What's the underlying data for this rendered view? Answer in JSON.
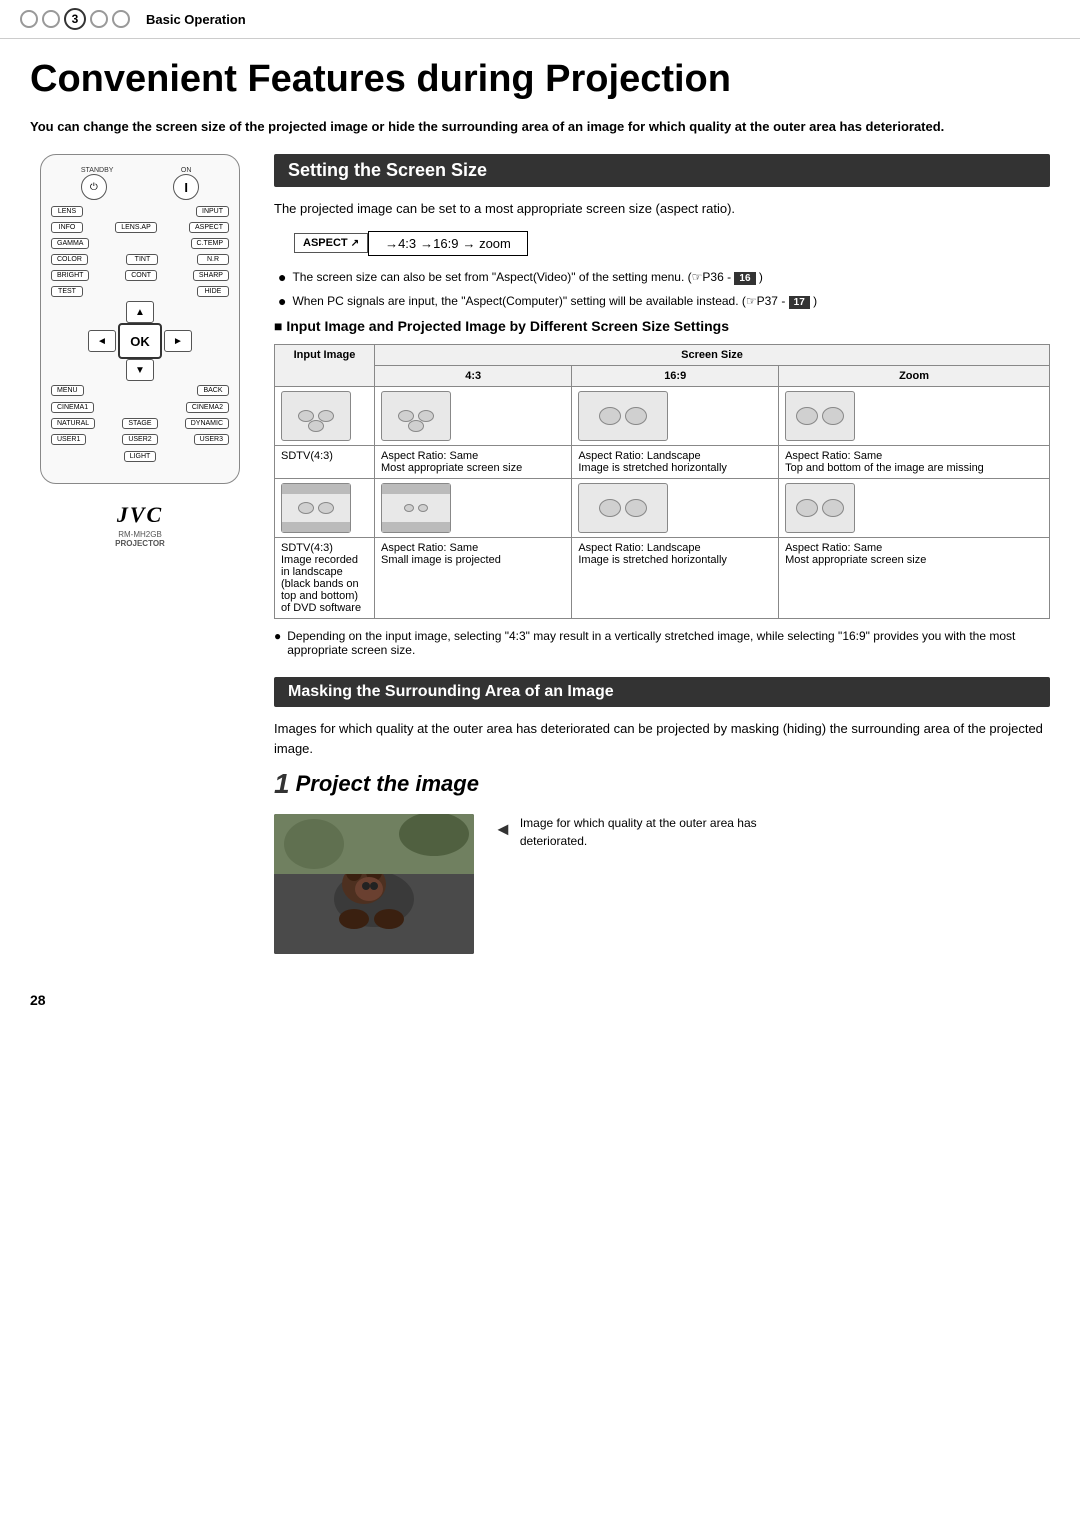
{
  "header": {
    "step_number": "3",
    "title": "Basic Operation"
  },
  "main_title": "Convenient Features during Projection",
  "intro_text": "You can change the screen size of the projected image or hide the surrounding area of an image for which quality at the outer area has deteriorated.",
  "section1": {
    "title": "Setting the Screen Size",
    "text": "The projected image can be set to a most appropriate screen size (aspect ratio).",
    "aspect_btn": "ASPECT",
    "aspect_sequence": "→4:3 →16:9 → zoom",
    "bullets": [
      "The screen size can also be set from \"Aspect(Video)\" of the setting menu. (☞P36 - 16 )",
      "When PC signals are input, the \"Aspect(Computer)\" setting will be available instead. (☞P37 - 17 )"
    ],
    "table_section_title": "■ Input Image and Projected Image by Different Screen Size Settings",
    "table": {
      "header_col1": "Input Image",
      "header_screen_size": "Screen Size",
      "col_43": "4:3",
      "col_169": "16:9",
      "col_zoom": "Zoom",
      "row1": {
        "label": "SDTV(4:3)",
        "col_43": "Aspect Ratio: Same\nMost appropriate screen size",
        "col_169": "Aspect Ratio: Landscape\nImage is stretched horizontally",
        "col_zoom": "Aspect Ratio: Same\nTop and bottom of the image are missing"
      },
      "row2": {
        "label": "SDTV(4:3)\nImage recorded in landscape (black bands on top and bottom) of DVD software",
        "col_43": "Aspect Ratio: Same\nSmall image is projected",
        "col_169": "Aspect Ratio: Landscape\nImage is stretched horizontally",
        "col_zoom": "Aspect Ratio: Same\nMost appropriate screen size"
      }
    },
    "note_text": "Depending on the input image, selecting \"4:3\" may result in a vertically stretched image, while selecting \"16:9\" provides you with the most appropriate screen size."
  },
  "section2": {
    "title": "Masking the Surrounding Area of an Image",
    "intro": "Images for which quality at the outer area has deteriorated can be projected by masking (hiding) the surrounding area of the projected image.",
    "step1": {
      "num": "1",
      "title": "Project the image",
      "caption": "Image for which quality at the outer area has deteriorated."
    }
  },
  "remote": {
    "standby_label": "STANDBY",
    "on_label": "ON",
    "buttons": {
      "lens": "LENS",
      "input": "INPUT",
      "info": "INFO",
      "lens_ap": "LENS.AP",
      "aspect": "ASPECT",
      "gamma": "GAMMA",
      "c_temp": "C.TEMP",
      "color": "COLOR",
      "tint": "TINT",
      "nr": "N.R",
      "bright": "BRIGHT",
      "cont": "CONT",
      "sharp": "SHARP",
      "test": "TEST",
      "hide": "HIDE",
      "ok": "OK",
      "menu": "MENU",
      "back": "BACK",
      "cinema1": "CINEMA1",
      "cinema2": "CINEMA2",
      "natural": "NATURAL",
      "stage": "STAGE",
      "dynamic": "DYNAMIC",
      "user1": "USER1",
      "user2": "USER2",
      "user3": "USER3",
      "light": "LIGHT"
    },
    "model": "RM-MH2GB",
    "type": "PROJECTOR",
    "logo": "JVC"
  },
  "page_number": "28"
}
